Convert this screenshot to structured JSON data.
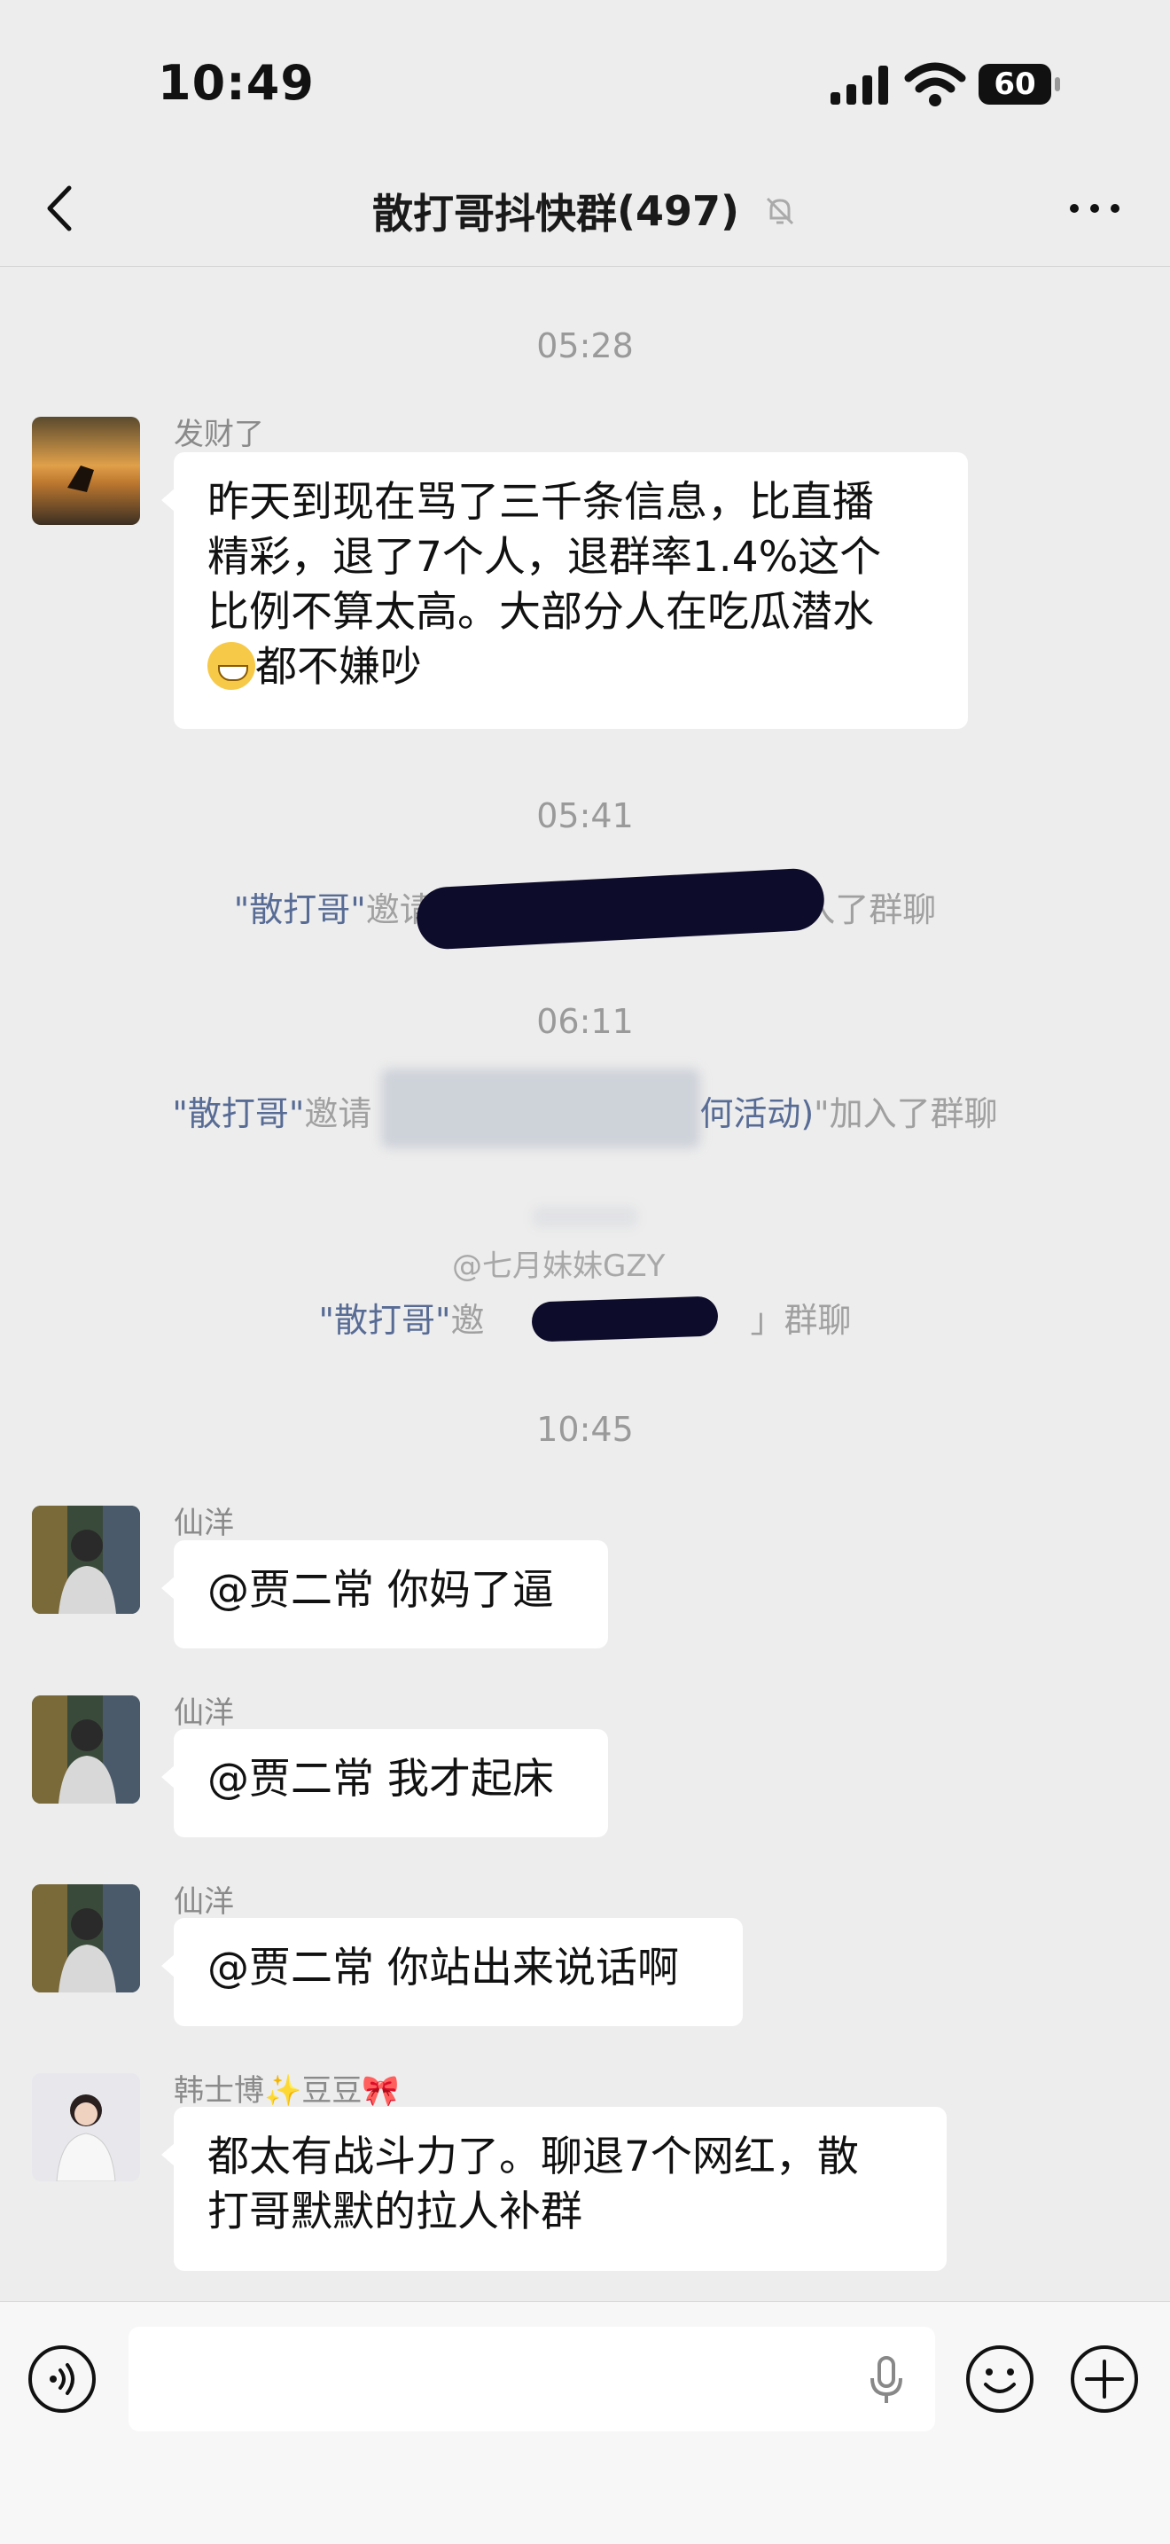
{
  "status_bar": {
    "time": "10:49",
    "battery": "60"
  },
  "nav": {
    "title": "散打哥抖快群",
    "member_count": "(497)"
  },
  "timestamps": {
    "t1": "05:28",
    "t2": "05:41",
    "t3": "06:11",
    "t4": "10:45"
  },
  "messages": [
    {
      "sender": "发财了",
      "text_line1": "昨天到现在骂了三千条信息，比直播",
      "text_line2": "精彩，退了7个人，退群率1.4%这个",
      "text_line3": "比例不算太高。大部分人在吃瓜潜水",
      "text_line4": "都不嫌吵"
    },
    {
      "sender": "仙洋",
      "text": "@贾二常 你妈了逼"
    },
    {
      "sender": "仙洋",
      "text": "@贾二常 我才起床"
    },
    {
      "sender": "仙洋",
      "text": "@贾二常 你站出来说话啊"
    },
    {
      "sender": "韩士博✨豆豆🎀",
      "text_line1": "都太有战斗力了。聊退7个网红，散",
      "text_line2": "打哥默默的拉人补群"
    }
  ],
  "system": {
    "s1_link": "\"散打哥\"",
    "s1_a": "邀请\"",
    "s1_b": "加入了群聊",
    "s2_link": "\"散打哥\"",
    "s2_a": "邀请",
    "s2_mid": "何活动)",
    "s2_b": "\"加入了群聊",
    "s3_link": "\"散打哥\"",
    "s3_a": "邀",
    "s3_b": "」群聊"
  },
  "watermark": "@七月妹妹GZY",
  "colors": {
    "background": "#ededed",
    "bubble": "#ffffff",
    "link": "#576b95"
  }
}
